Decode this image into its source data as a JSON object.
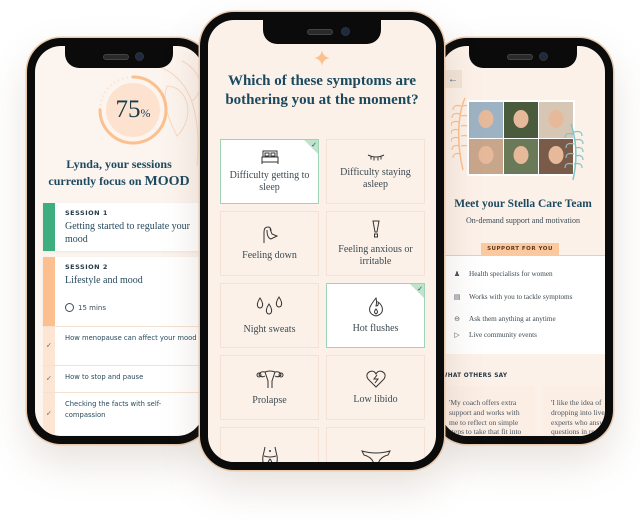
{
  "left_phone": {
    "progress_percent": 75,
    "progress_number": "75",
    "progress_symbol": "%",
    "focus_line1": "Lynda, your sessions",
    "focus_line2_prefix": "currently focus on ",
    "focus_topic": "MOOD",
    "sessions": [
      {
        "label": "SESSION 1",
        "title": "Getting started to regulate your mood",
        "status_color": "#3fae7e"
      },
      {
        "label": "SESSION 2",
        "title": "Lifestyle and mood",
        "duration": "15 mins",
        "status_color": "#fcc08f"
      }
    ],
    "sub_items": [
      {
        "text": "How menopause can affect your mood",
        "done": true
      },
      {
        "text": "How to stop and pause",
        "done": true
      },
      {
        "text": "Checking the facts with self-compassion",
        "done": true
      }
    ]
  },
  "middle_phone": {
    "question": "Which of these symptoms are bothering you at the moment?",
    "symptoms": [
      {
        "label": "Difficulty getting to sleep",
        "icon": "bed-icon",
        "selected": true
      },
      {
        "label": "Difficulty staying asleep",
        "icon": "closed-eye-icon",
        "selected": false
      },
      {
        "label": "Feeling down",
        "icon": "sad-face-profile-icon",
        "selected": false
      },
      {
        "label": "Feeling anxious or irritable",
        "icon": "exclamation-icon",
        "selected": false
      },
      {
        "label": "Night sweats",
        "icon": "droplets-icon",
        "selected": false
      },
      {
        "label": "Hot flushes",
        "icon": "flame-icon",
        "selected": true
      },
      {
        "label": "Prolapse",
        "icon": "uterus-icon",
        "selected": false
      },
      {
        "label": "Low libido",
        "icon": "broken-heart-icon",
        "selected": false
      },
      {
        "label": "",
        "icon": "waist-icon",
        "selected": false
      },
      {
        "label": "",
        "icon": "underwear-icon",
        "selected": false
      }
    ]
  },
  "right_phone": {
    "back_icon": "arrow-left-icon",
    "team_title": "Meet your Stella Care Team",
    "team_subtitle": "On-demand support and motivation",
    "support_tab": "SUPPORT FOR YOU",
    "support_items": [
      {
        "icon": "person-icon",
        "text": "Health specialists for women"
      },
      {
        "icon": "document-icon",
        "text": "Works with you to tackle symptoms"
      },
      {
        "icon": "chat-icon",
        "text": "Ask them anything at anytime"
      },
      {
        "icon": "play-icon",
        "text": "Live community events"
      }
    ],
    "others_label": "WHAT OTHERS SAY",
    "quotes": [
      "'My coach offers extra support and works with me to reflect on simple steps to take that fit into my life.'",
      "'I like the idea of dropping into live with experts who answer my questions in real time'"
    ]
  },
  "colors": {
    "accent_navy": "#1d4a60",
    "peach": "#fcc99f",
    "green": "#3fae7e",
    "screen_bg": "#fcf1e9"
  }
}
